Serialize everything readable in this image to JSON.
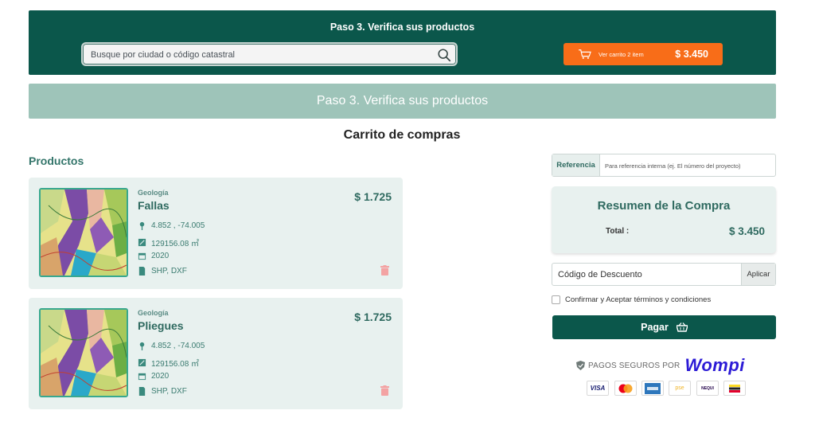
{
  "header": {
    "title": "Paso 3. Verifica sus productos",
    "search_placeholder": "Busque por ciudad o código catastral",
    "cart_label": "Ver carrito 2 item",
    "cart_total": "$ 3.450"
  },
  "banner": {
    "title": "Paso 3. Verifica sus productos"
  },
  "cart_title": "Carrito de compras",
  "products_title": "Productos",
  "products": [
    {
      "category": "Geología",
      "name": "Fallas",
      "price": "$ 1.725",
      "coords": "4.852 , -74.005",
      "area": "129156.08 ㎡",
      "year": "2020",
      "formats": "SHP, DXF"
    },
    {
      "category": "Geología",
      "name": "Pliegues",
      "price": "$ 1.725",
      "coords": "4.852 , -74.005",
      "area": "129156.08 ㎡",
      "year": "2020",
      "formats": "SHP, DXF"
    }
  ],
  "reference": {
    "label": "Referencia",
    "placeholder": "Para referencia interna (ej. El número del proyecto)"
  },
  "summary": {
    "title": "Resumen de la Compra",
    "total_label": "Total :",
    "total_value": "$ 3.450"
  },
  "discount": {
    "placeholder": "Código de Descuento",
    "apply_label": "Aplicar"
  },
  "terms_label": "Confirmar y Aceptar términos y condiciones",
  "pay_label": "Pagar",
  "secure": {
    "text": "PAGOS SEGUROS POR",
    "brand": "Wompi"
  },
  "payment_methods": [
    {
      "label": "VISA",
      "icon": "visa-icon"
    },
    {
      "label": "",
      "icon": "mastercard-icon"
    },
    {
      "label": "",
      "icon": "amex-icon"
    },
    {
      "label": "pse",
      "icon": "pse-icon"
    },
    {
      "label": "NEQUI",
      "icon": "nequi-icon"
    },
    {
      "label": "",
      "icon": "bancolombia-icon"
    }
  ],
  "colors": {
    "primary": "#0b574b",
    "accent": "#f86d18",
    "banner": "#9ec4b9",
    "card_bg": "#e8f1ef",
    "brand_wompi": "#2c1bd6"
  }
}
